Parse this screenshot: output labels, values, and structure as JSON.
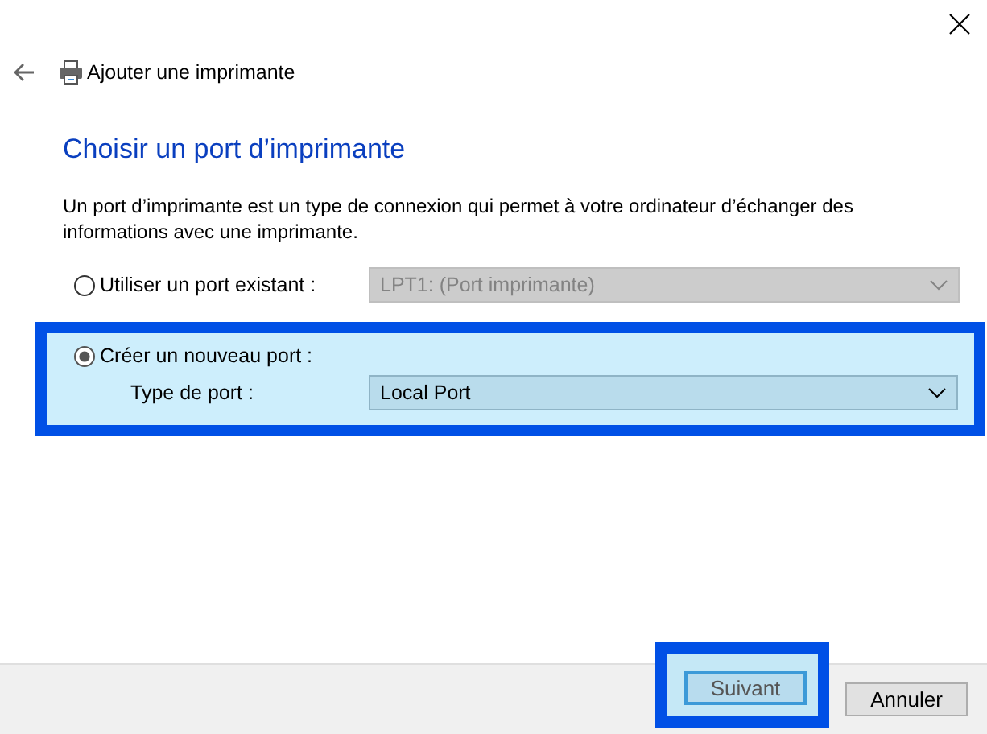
{
  "header": {
    "title": "Ajouter une imprimante"
  },
  "heading": "Choisir un port d’imprimante",
  "description": "Un port d’imprimante est un type de connexion qui permet à votre ordinateur d’échanger des informations avec une imprimante.",
  "options": [
    {
      "label": "Utiliser un port existant :",
      "selected": false,
      "highlighted": false,
      "fields": [
        {
          "value": "LPT1: (Port imprimante)",
          "disabled": true
        }
      ]
    },
    {
      "label": "Créer un nouveau port :",
      "selected": true,
      "highlighted": true,
      "fields": [
        {
          "label": "Type de port :",
          "value": "Local Port",
          "disabled": false
        }
      ]
    }
  ],
  "buttons": [
    {
      "label": "Suivant",
      "default": true,
      "highlighted": true
    },
    {
      "label": "Annuler",
      "default": false,
      "highlighted": false
    }
  ]
}
